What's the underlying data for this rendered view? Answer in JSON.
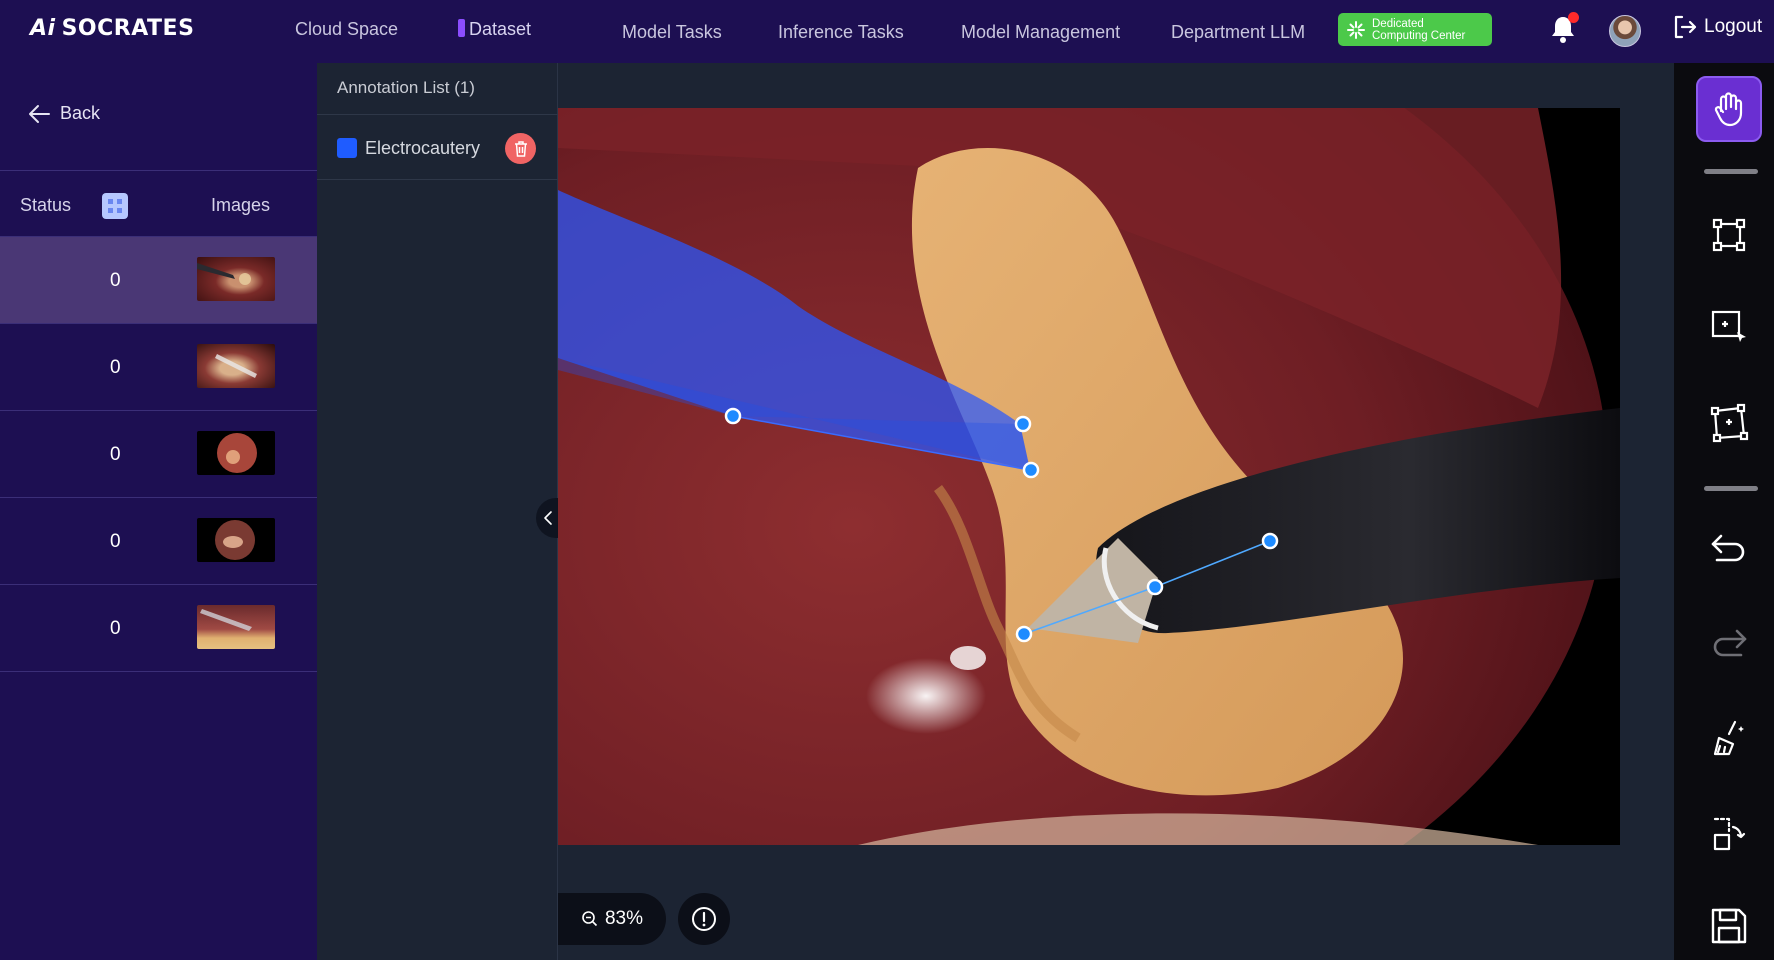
{
  "app": {
    "name": "SOCRATES",
    "logo_mark": "Ai"
  },
  "nav": {
    "items": [
      {
        "label": "Cloud Space"
      },
      {
        "label": "Dataset"
      },
      {
        "label": "Model Tasks"
      },
      {
        "label": "Inference Tasks"
      },
      {
        "label": "Model Management"
      },
      {
        "label": "Department LLM"
      }
    ],
    "active": "Dataset"
  },
  "header": {
    "badge_line1": "Dedicated",
    "badge_line2": "Computing Center",
    "notification_icon": "bell-icon",
    "logout_label": "Logout"
  },
  "left_panel": {
    "back_label": "Back",
    "columns": {
      "status": "Status",
      "images": "Images"
    },
    "rows": [
      {
        "status": "0",
        "selected": true
      },
      {
        "status": "0",
        "selected": false
      },
      {
        "status": "0",
        "selected": false
      },
      {
        "status": "0",
        "selected": false
      },
      {
        "status": "0",
        "selected": false
      }
    ]
  },
  "annotations": {
    "title": "Annotation List (1)",
    "items": [
      {
        "label": "Electrocautery",
        "color": "#1f5cff"
      }
    ]
  },
  "canvas": {
    "zoom": "83%"
  },
  "toolbar": {
    "tools": [
      "hand-icon",
      "bounding-box-icon",
      "smart-select-icon",
      "polygon-icon",
      "undo-icon",
      "redo-icon",
      "clear-icon",
      "replace-icon",
      "save-icon"
    ],
    "active": "hand-icon"
  },
  "colors": {
    "accent": "#6a2fd2",
    "brand_bg": "#1d0f52",
    "badge": "#4cc94a",
    "annotation": "#1f5cff"
  }
}
